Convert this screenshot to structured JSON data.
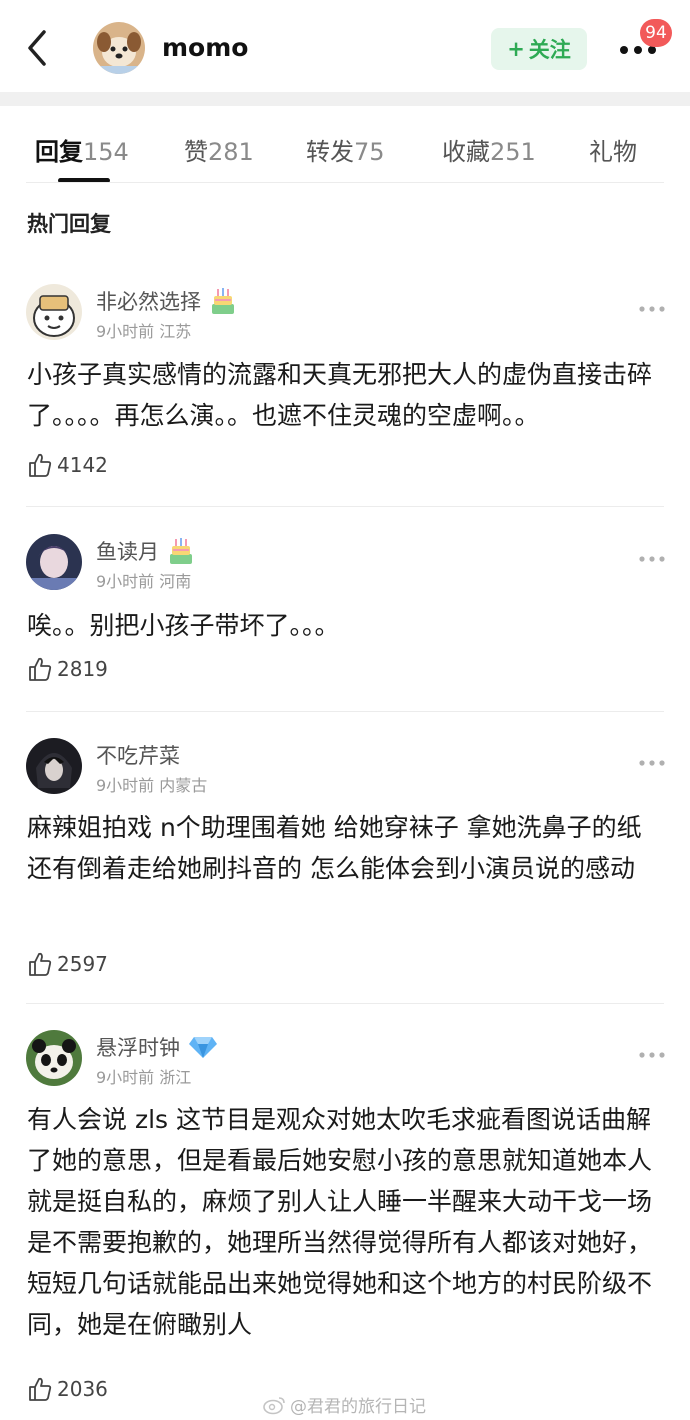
{
  "header": {
    "username": "momo",
    "follow_label": "关注",
    "badge_count": "94"
  },
  "tabs": [
    {
      "label": "回复",
      "count": "154",
      "active": true
    },
    {
      "label": "赞",
      "count": "281",
      "active": false
    },
    {
      "label": "转发",
      "count": "75",
      "active": false
    },
    {
      "label": "收藏",
      "count": "251",
      "active": false
    },
    {
      "label": "礼物",
      "count": "",
      "active": false
    }
  ],
  "section_title": "热门回复",
  "comments": [
    {
      "name": "非必然选择",
      "badge": "cake-icon",
      "time": "9小时前",
      "location": "江苏",
      "text": "小孩子真实感情的流露和天真无邪把大人的虚伪直接击碎了。。。。再怎么演。。也遮不住灵魂的空虚啊。。",
      "likes": "4142"
    },
    {
      "name": "鱼读月",
      "badge": "cake-icon",
      "time": "9小时前",
      "location": "河南",
      "text": "唉。。别把小孩子带坏了。。。",
      "likes": "2819"
    },
    {
      "name": "不吃芹菜",
      "badge": "",
      "time": "9小时前",
      "location": "内蒙古",
      "text": "麻辣姐拍戏 n个助理围着她 给她穿袜子 拿她洗鼻子的纸 还有倒着走给她刷抖音的 怎么能体会到小演员说的感动",
      "likes": "2597"
    },
    {
      "name": "悬浮时钟",
      "badge": "diamond-icon",
      "time": "9小时前",
      "location": "浙江",
      "text": "有人会说 zls 这节目是观众对她太吹毛求疵看图说话曲解了她的意思，但是看最后她安慰小孩的意思就知道她本人就是挺自私的，麻烦了别人让人睡一半醒来大动干戈一场是不需要抱歉的，她理所当然得觉得所有人都该对她好，短短几句话就能品出来她觉得她和这个地方的村民阶级不同，她是在俯瞰别人",
      "likes": "2036"
    }
  ],
  "watermark": "@君君的旅行日记",
  "colors": {
    "accent_green": "#2eaa54",
    "follow_bg": "#e6f6ec",
    "badge_red": "#f25a5a"
  }
}
